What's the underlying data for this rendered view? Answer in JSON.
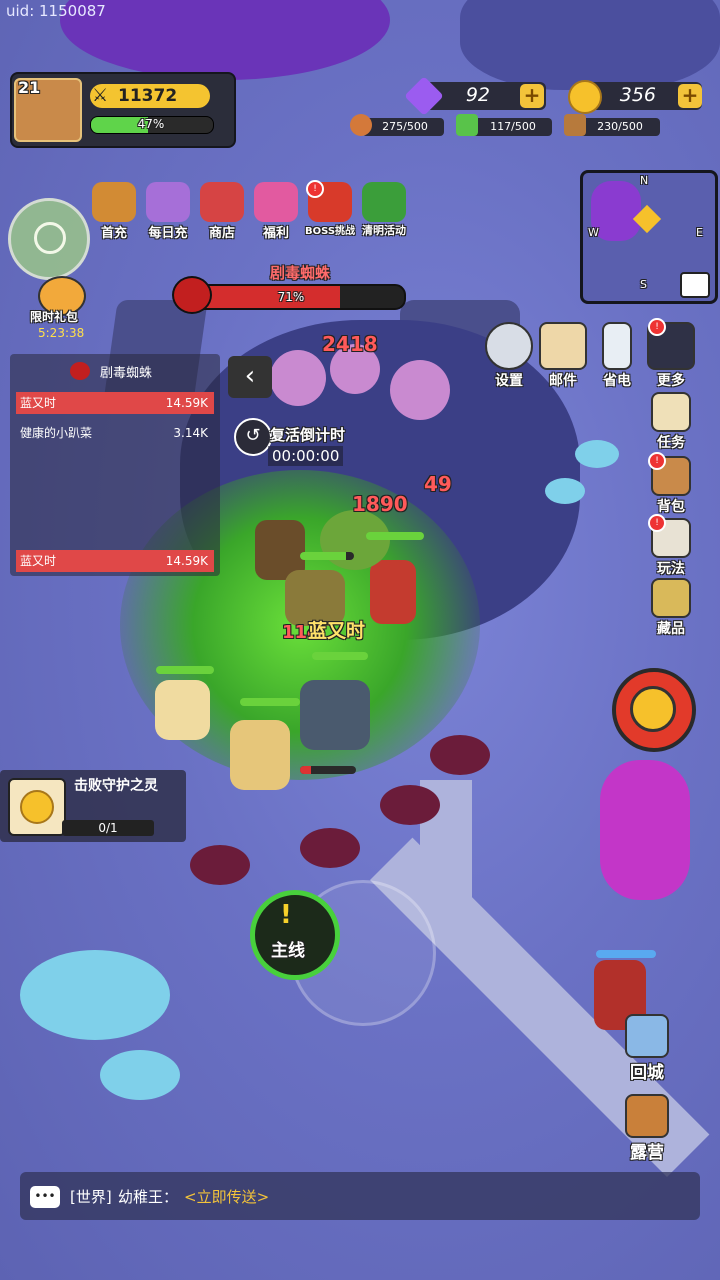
{
  "uid": "uid: 1150087",
  "player": {
    "level": "21",
    "power": "11372",
    "exp_percent": 47,
    "exp_label": "47%"
  },
  "currencies": {
    "gems": "92",
    "gold": "356"
  },
  "resources": {
    "meat": "275/500",
    "herb": "117/500",
    "wood": "230/500"
  },
  "activities": [
    "首充",
    "每日充",
    "商店",
    "福利",
    "BOSS挑战",
    "清明活动"
  ],
  "limited_gift": {
    "label": "限时礼包",
    "timer": "5:23:38"
  },
  "minimap": {
    "north": "N",
    "south": "S",
    "west": "W",
    "east": "E"
  },
  "system_buttons": [
    "设置",
    "邮件",
    "省电",
    "更多"
  ],
  "boss": {
    "name": "剧毒蜘蛛",
    "hp_percent": 71,
    "hp_label": "71%"
  },
  "damage_panel": {
    "title": "剧毒蜘蛛",
    "rows": [
      {
        "name": "蓝又时",
        "value": "14.59K"
      },
      {
        "name": "健康的小趴菜",
        "value": "3.14K"
      }
    ],
    "self_row": {
      "name": "蓝又时",
      "value": "14.59K"
    }
  },
  "revive": {
    "label": "复活倒计时",
    "timer": "00:00:00"
  },
  "combat_numbers": [
    "2418",
    "49",
    "1890",
    "114"
  ],
  "player_name_tag": "蓝又时",
  "right_buttons": [
    "任务",
    "背包",
    "玩法",
    "藏品"
  ],
  "quest": {
    "title": "击败守护之灵",
    "progress": "0/1"
  },
  "main_line": "主线",
  "bottom_buttons": [
    "回城",
    "露营"
  ],
  "chat": {
    "channel": "[世界]",
    "sender": "幼稚王：",
    "message": "<立即传送>"
  },
  "colors": {
    "accent_green": "#48d03c",
    "boss_red": "#d42d2d",
    "gold": "#f6c12b",
    "gem": "#9b5cf0"
  }
}
